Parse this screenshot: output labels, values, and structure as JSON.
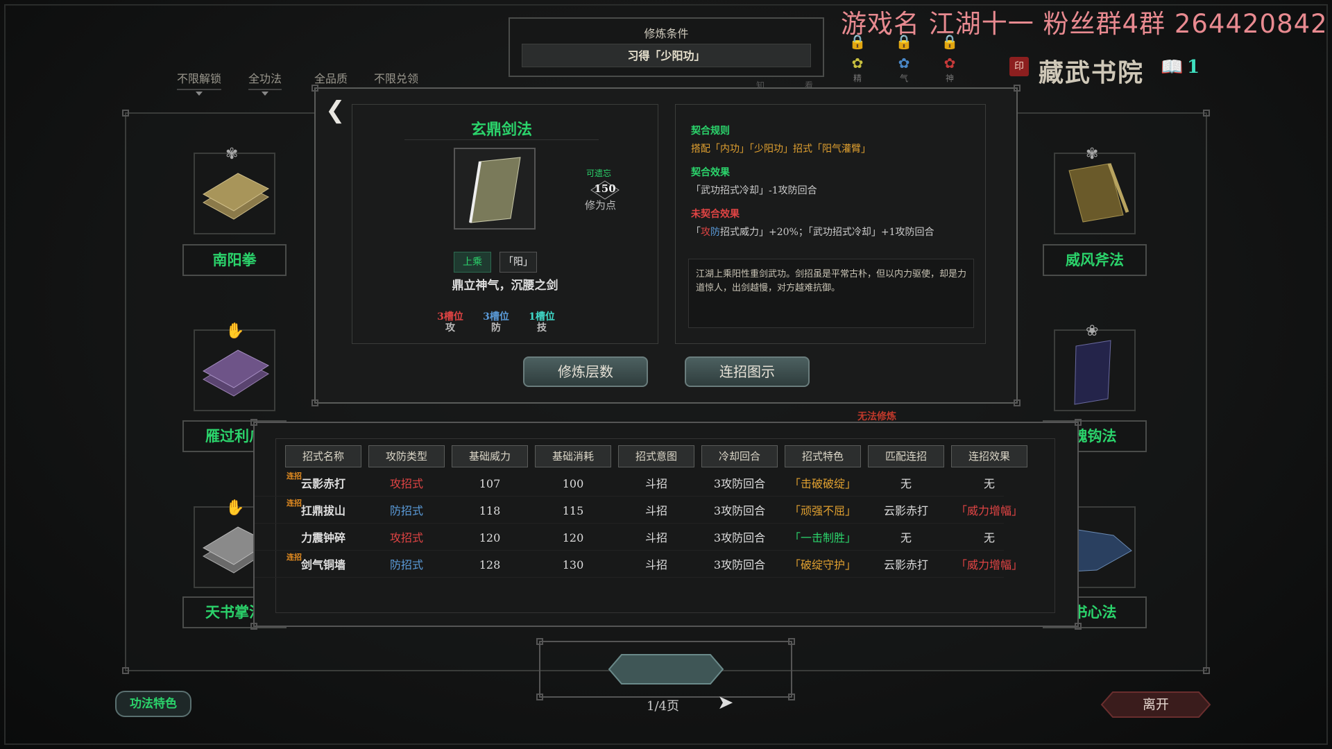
{
  "watermark": "游戏名 江湖十一  粉丝群4群 264420842",
  "requirement": {
    "title": "修炼条件",
    "value": "习得「少阳功」"
  },
  "filters": [
    "不限解锁",
    "全功法",
    "全品质",
    "不限兑领"
  ],
  "locked_slots": [
    {
      "label": "精",
      "icon": "dragon-emblem-icon",
      "color": "#c8c040"
    },
    {
      "label": "气",
      "icon": "blue-emblem-icon",
      "color": "#4a88c8"
    },
    {
      "label": "神",
      "icon": "red-emblem-icon",
      "color": "#c83a3a"
    }
  ],
  "extra_labels": [
    "知",
    "看"
  ],
  "academy": {
    "name": "藏武书院",
    "book_count": "1"
  },
  "side_books": {
    "left": [
      "南阳拳",
      "雁过利爪",
      "天书掌法"
    ],
    "right": [
      "威风斧法",
      "魂钩法",
      "书心法"
    ]
  },
  "skill": {
    "name": "玄鼎剑法",
    "forgettable_label": "可遗忘",
    "points": "150",
    "points_label": "修为点",
    "tags": [
      "上乘",
      "「阳」"
    ],
    "motto": "鼎立神气，沉腰之剑",
    "slots": [
      {
        "count": "3槽位",
        "type": "攻",
        "color": "#e04444"
      },
      {
        "count": "3槽位",
        "type": "防",
        "color": "#5a9ad8"
      },
      {
        "count": "1槽位",
        "type": "技",
        "color": "#3fd8c8"
      }
    ]
  },
  "rules": {
    "match_rule_title": "契合规则",
    "match_rule_value": "搭配「内功」「少阳功」招式「阳气灌臂」",
    "match_effect_title": "契合效果",
    "match_effect_value": "「武功招式冷却」-1攻防回合",
    "unmatched_title": "未契合效果",
    "unmatched_value_prefix": "「",
    "unmatched_value_atk": "攻",
    "unmatched_value_def": "防",
    "unmatched_value_rest": "招式威力」+20%；「武功招式冷却」+1攻防回合",
    "description": "江湖上乘阳性重剑武功。剑招虽是平常古朴，但以内力驱使，却是力道惊人，出剑越慢，对方越难抗御。"
  },
  "buttons": {
    "train": "修炼层数",
    "combo": "连招图示",
    "feature": "功法特色",
    "leave": "离开"
  },
  "cannot_train": "无法修炼",
  "table": {
    "headers": [
      "招式名称",
      "攻防类型",
      "基础威力",
      "基础消耗",
      "招式意图",
      "冷却回合",
      "招式特色",
      "匹配连招",
      "连招效果"
    ],
    "rows": [
      {
        "combo": "连招",
        "name": "云影赤打",
        "type": "攻招式",
        "type_class": "atk",
        "power": "107",
        "cost": "100",
        "intent": "斗招",
        "cd": "3攻防回合",
        "feature": "「击破破绽」",
        "feature_class": "orange",
        "match": "无",
        "effect": "无",
        "effect_class": ""
      },
      {
        "combo": "连招",
        "name": "扛鼎拔山",
        "type": "防招式",
        "type_class": "def",
        "power": "118",
        "cost": "115",
        "intent": "斗招",
        "cd": "3攻防回合",
        "feature": "「顽强不屈」",
        "feature_class": "orange",
        "match": "云影赤打",
        "effect": "「威力增幅」",
        "effect_class": "red"
      },
      {
        "combo": "",
        "name": "力震钟碎",
        "type": "攻招式",
        "type_class": "atk",
        "power": "120",
        "cost": "120",
        "intent": "斗招",
        "cd": "3攻防回合",
        "feature": "「一击制胜」",
        "feature_class": "green",
        "match": "无",
        "effect": "无",
        "effect_class": ""
      },
      {
        "combo": "连招",
        "name": "剑气铜墙",
        "type": "防招式",
        "type_class": "def",
        "power": "128",
        "cost": "130",
        "intent": "斗招",
        "cd": "3攻防回合",
        "feature": "「破绽守护」",
        "feature_class": "orange",
        "match": "云影赤打",
        "effect": "「威力增幅」",
        "effect_class": "red"
      }
    ]
  },
  "pager": {
    "page": "1/4页"
  }
}
